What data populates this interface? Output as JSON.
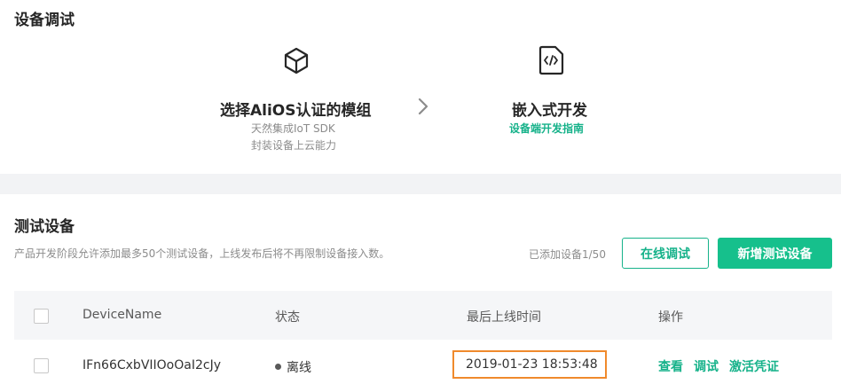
{
  "debug": {
    "title": "设备调试",
    "steps": [
      {
        "icon": "cube-icon",
        "title": "选择AliOS认证的模组",
        "desc_line1": "天然集成IoT SDK",
        "desc_line2": "封装设备上云能力"
      },
      {
        "icon": "code-document-icon",
        "title": "嵌入式开发",
        "link": "设备端开发指南"
      }
    ]
  },
  "test_devices": {
    "title": "测试设备",
    "hint": "产品开发阶段允许添加最多50个测试设备，上线发布后将不再限制设备接入数。",
    "count_text": "已添加设备1/50",
    "online_debug_button": "在线调试",
    "add_device_button": "新增测试设备",
    "table": {
      "columns": [
        "DeviceName",
        "状态",
        "最后上线时间",
        "操作"
      ],
      "rows": [
        {
          "device_name": "IFn66CxbVIIOoOaI2cJy",
          "status": "离线",
          "last_online": "2019-01-23 18:53:48",
          "actions": [
            "查看",
            "调试",
            "激活凭证"
          ]
        }
      ]
    }
  },
  "colors": {
    "accent": "#16b28a",
    "primary_button": "#16c08c",
    "highlight_border": "#f08a2c"
  }
}
